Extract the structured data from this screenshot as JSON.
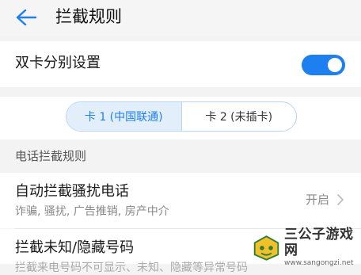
{
  "header": {
    "title": "拦截规则"
  },
  "dual_card": {
    "label": "双卡分别设置",
    "enabled": true
  },
  "sim_tabs": [
    {
      "label": "卡 1 (中国联通)",
      "active": true
    },
    {
      "label": "卡 2 (未插卡)",
      "active": false
    }
  ],
  "section": {
    "title": "电话拦截规则"
  },
  "auto_block": {
    "title": "自动拦截骚扰电话",
    "subtitle": "诈骗, 骚扰, 广告推销, 房产中介",
    "value": "开启"
  },
  "unknown_block": {
    "title": "拦截未知/隐藏号码",
    "subtitle": "拦截来电号码不可显示、未知、隐藏等异常号码"
  },
  "watermark": {
    "name": "三公子游戏网",
    "url": "www.sangongzi.net"
  },
  "colors": {
    "accent": "#1e7ff0",
    "background": "#f3f3f3"
  }
}
